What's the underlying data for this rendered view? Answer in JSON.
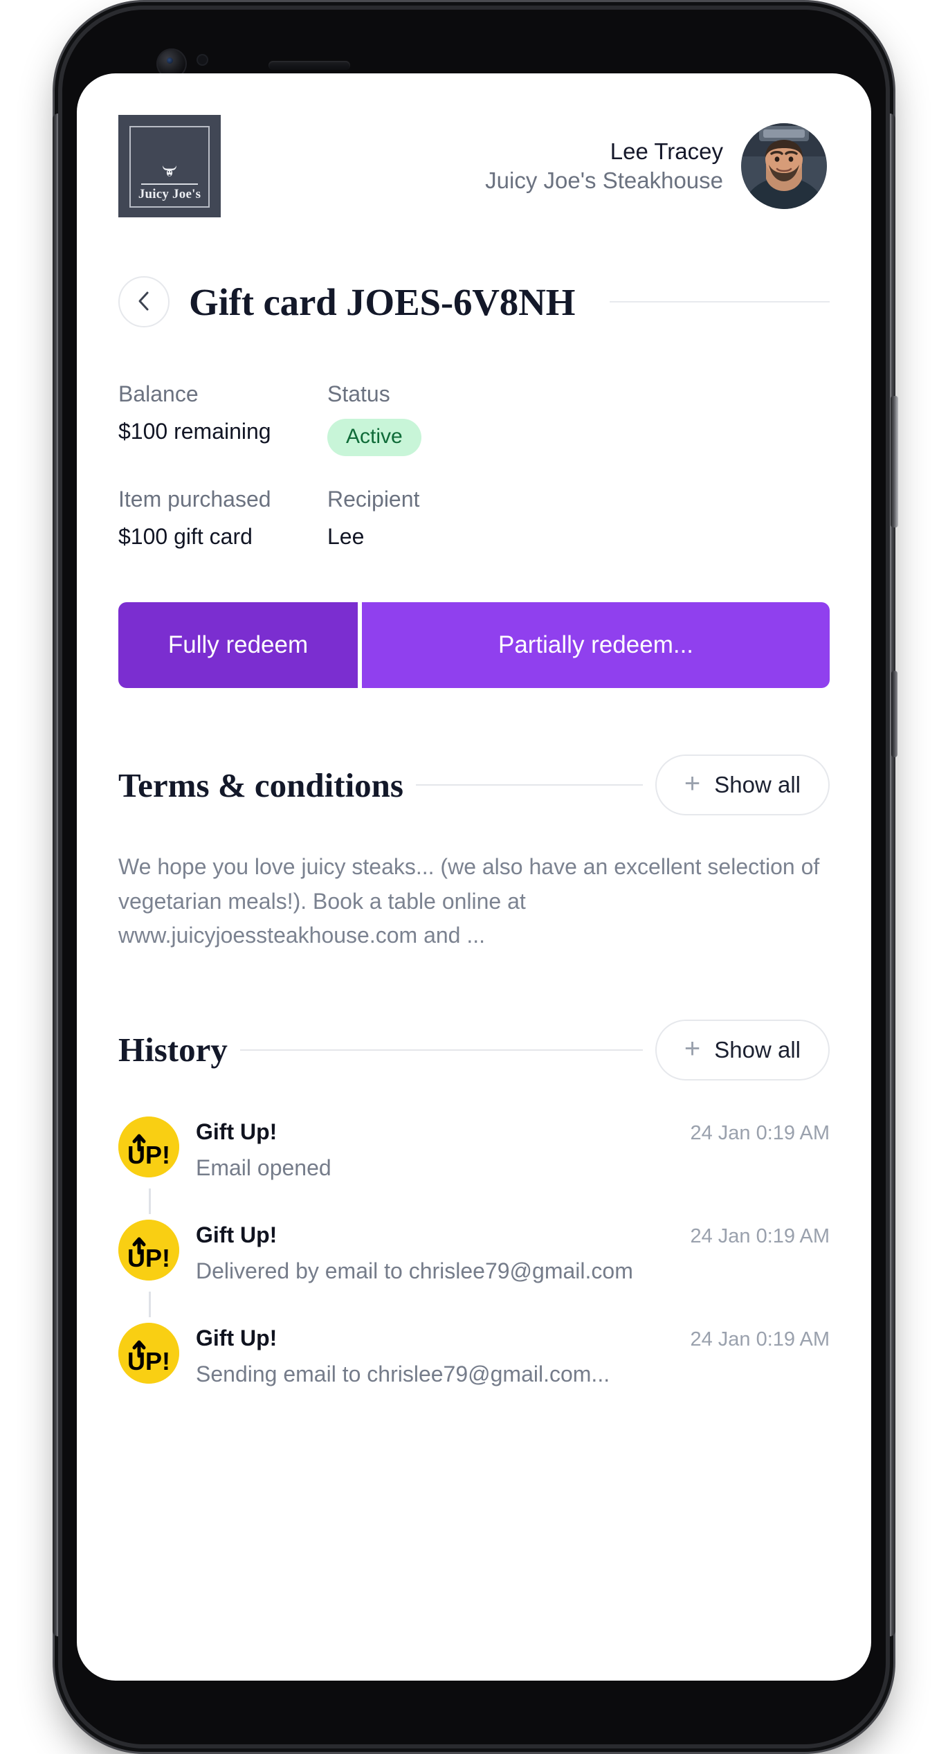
{
  "header": {
    "logo": {
      "brand_name": "Juicy Joe's",
      "icon": "bull-head-icon",
      "bg_color": "#414755"
    },
    "user_name": "Lee Tracey",
    "merchant_name": "Juicy Joe's Steakhouse",
    "avatar_alt": "user-avatar"
  },
  "page": {
    "back_icon": "chevron-left-icon",
    "title": "Gift card JOES-6V8NH"
  },
  "details": [
    {
      "label": "Balance",
      "value": "$100 remaining",
      "type": "text"
    },
    {
      "label": "Status",
      "value": "Active",
      "type": "badge",
      "badge_bg": "#c8f5d8",
      "badge_fg": "#0f6b38"
    },
    {
      "label": "Item purchased",
      "value": "$100 gift card",
      "type": "text"
    },
    {
      "label": "Recipient",
      "value": "Lee",
      "type": "text"
    }
  ],
  "actions": {
    "fully_redeem_label": "Fully redeem",
    "partially_redeem_label": "Partially redeem...",
    "primary_color": "#7b2ed0",
    "secondary_color": "#9040ee"
  },
  "terms": {
    "title": "Terms & conditions",
    "show_all_label": "Show all",
    "plus_icon": "plus-icon",
    "body": "We hope you love juicy steaks... (we also have an excellent selection of vegetarian meals!). Book a table online at www.juicyjoessteakhouse.com and ..."
  },
  "history": {
    "title": "History",
    "show_all_label": "Show all",
    "plus_icon": "plus-icon",
    "items": [
      {
        "source": "Gift Up!",
        "time": "24 Jan 0:19 AM",
        "description": "Email opened",
        "avatar": "gift-up-logo"
      },
      {
        "source": "Gift Up!",
        "time": "24 Jan 0:19 AM",
        "description": "Delivered by email to chrislee79@gmail.com",
        "avatar": "gift-up-logo"
      },
      {
        "source": "Gift Up!",
        "time": "24 Jan 0:19 AM",
        "description": "Sending email to chrislee79@gmail.com...",
        "avatar": "gift-up-logo"
      }
    ]
  }
}
